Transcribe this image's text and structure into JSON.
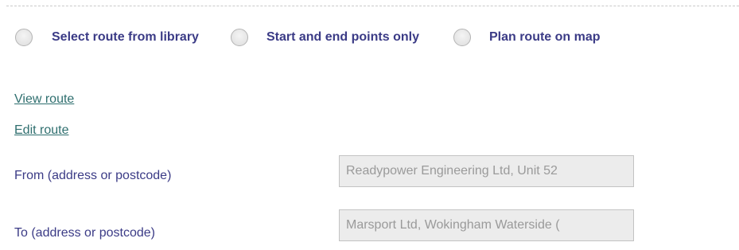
{
  "route_mode": {
    "options": [
      {
        "label": "Select route from library",
        "selected": false
      },
      {
        "label": "Start and end points only",
        "selected": false
      },
      {
        "label": "Plan route on map",
        "selected": false
      }
    ]
  },
  "links": {
    "view_route": "View route",
    "edit_route": "Edit route"
  },
  "form": {
    "from": {
      "label": "From (address or postcode)",
      "value": "Readypower Engineering Ltd, Unit 52"
    },
    "to": {
      "label": "To (address or postcode)",
      "value": "Marsport Ltd, Wokingham Waterside ("
    }
  },
  "colors": {
    "label_text": "#3b3b86",
    "link_text": "#2f6f6f",
    "input_background": "#ececec",
    "input_text": "#9a9a9a"
  }
}
